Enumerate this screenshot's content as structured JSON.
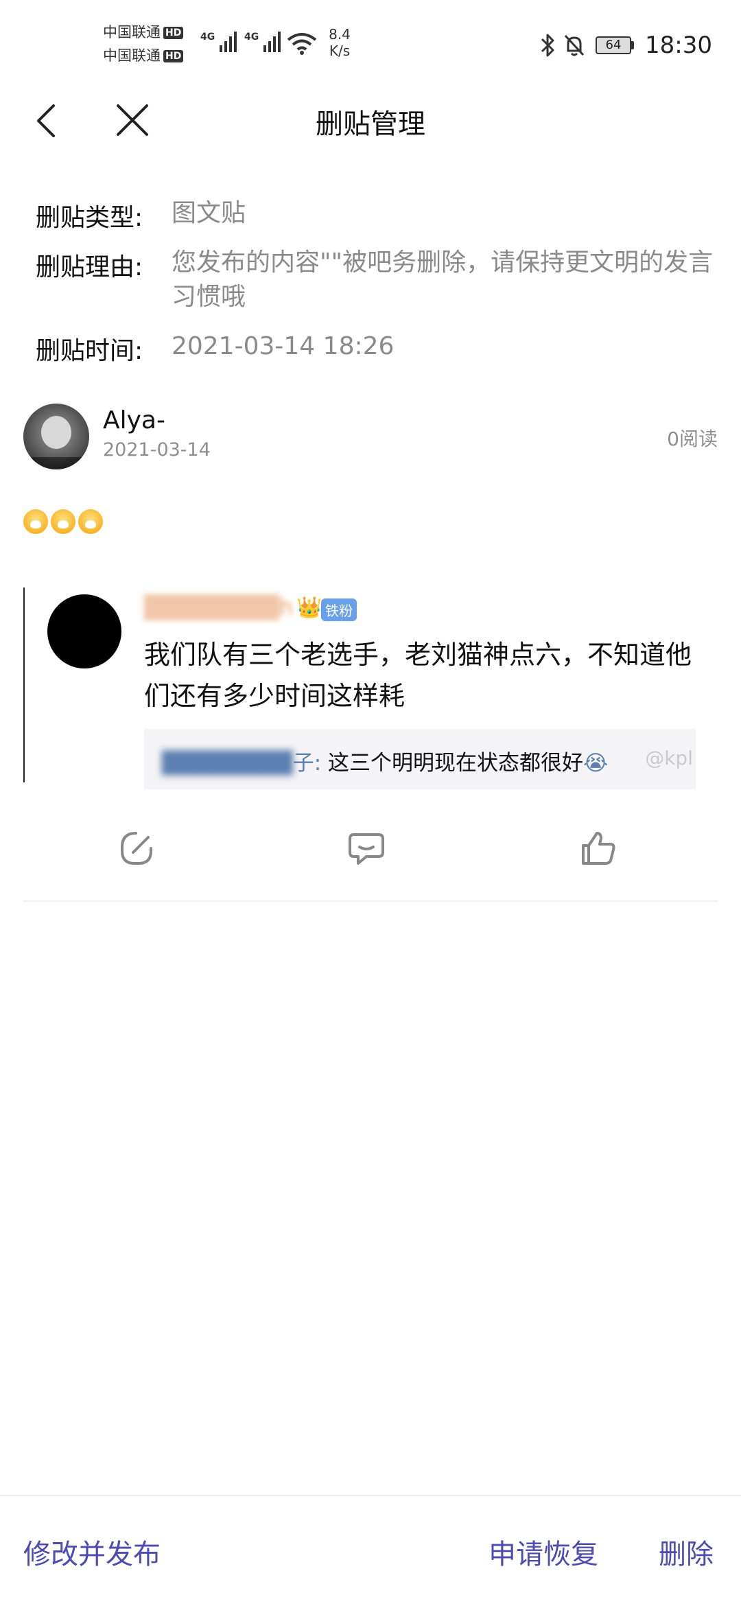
{
  "status_bar": {
    "carrier1": "中国联通",
    "carrier2": "中国联通",
    "hd": "HD",
    "net": "4G",
    "speed_value": "8.4",
    "speed_unit": "K/s",
    "battery": "64",
    "time": "18:30"
  },
  "header": {
    "title": "删贴管理"
  },
  "info": {
    "type_label": "删贴类型:",
    "type_value": "图文贴",
    "reason_label": "删贴理由:",
    "reason_value": "您发布的内容\"\"被吧务删除，请保持更文明的发言习惯哦",
    "time_label": "删贴时间:",
    "time_value": "2021-03-14 18:26"
  },
  "post": {
    "author": "Alya-",
    "date": "2021-03-14",
    "read_count": "0阅读",
    "quote": {
      "username": "h",
      "badge": "铁粉",
      "text": "我们队有三个老选手，老刘猫神点六，不知道他们还有多少时间这样耗",
      "reply_user_suffix": "子:",
      "reply_text": " 这三个明明现在状态都很好",
      "watermark": "@kpl"
    }
  },
  "actions": {
    "edit_icon": "edit-icon",
    "comment_icon": "comment-icon",
    "like_icon": "thumbs-up-icon"
  },
  "bottom_bar": {
    "edit_publish": "修改并发布",
    "appeal": "申请恢复",
    "delete": "删除"
  },
  "colors": {
    "accent": "#4b4bb0",
    "muted": "#8a8a8a"
  }
}
